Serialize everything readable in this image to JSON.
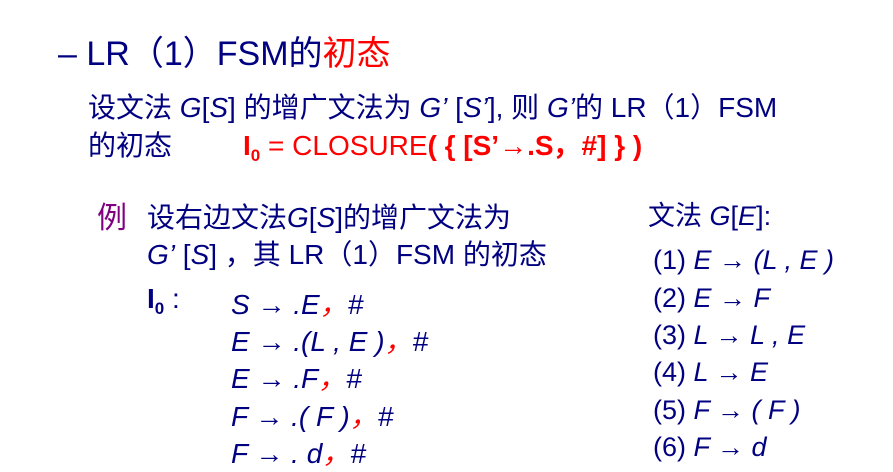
{
  "heading": {
    "dash": "–",
    "text_black": "LR（1）FSM的",
    "text_red": "初态"
  },
  "intro": {
    "line1": {
      "p1": "设文法 ",
      "g1": "G",
      "b1": "[",
      "s1": "S",
      "b2": "] 的增广文法为 ",
      "g2": "G’",
      "b3": " [",
      "s2": "S’",
      "b4": "], 则 ",
      "g3": "G’",
      "p2": "的 LR（1）FSM"
    },
    "line2": {
      "p1": "的初态",
      "i": "I",
      "sub": "0",
      "eq": " = CLOSURE",
      "rest": "( { [S’→.S，#] } )"
    }
  },
  "example": {
    "label": "例",
    "line1": {
      "p1": "设右边文法",
      "g": "G",
      "b1": "[",
      "s": "S",
      "p2": "]的增广文法为"
    },
    "line2": {
      "g": "G’",
      "b1": " [",
      "s": "S",
      "p2": "] ，其 LR（1）FSM 的初态"
    },
    "state_label": "I",
    "state_sub": "0",
    "state_colon": " :",
    "items": [
      {
        "prod": "S → .E",
        "sep": "，",
        "la": "#"
      },
      {
        "prod": "E → .(L , E )",
        "sep": "，",
        "la": "#"
      },
      {
        "prod": "E → .F",
        "sep": "，",
        "la": "#"
      },
      {
        "prod": "F → .( F )",
        "sep": "，",
        "la": "#"
      },
      {
        "prod": "F → . d",
        "sep": "，",
        "la": "#"
      }
    ]
  },
  "grammar": {
    "title_cn": "文法 ",
    "title_g": "G",
    "title_b1": "[",
    "title_e": "E",
    "title_b2": "]:",
    "rules": [
      {
        "num": "(1) ",
        "body": "E → (L , E )"
      },
      {
        "num": "(2) ",
        "body": "E → F"
      },
      {
        "num": "(3) ",
        "body": "L → L , E"
      },
      {
        "num": "(4) ",
        "body": "L → E"
      },
      {
        "num": "(5) ",
        "body": "F → ( F )"
      },
      {
        "num": "(6) ",
        "body": "F → d"
      }
    ]
  }
}
